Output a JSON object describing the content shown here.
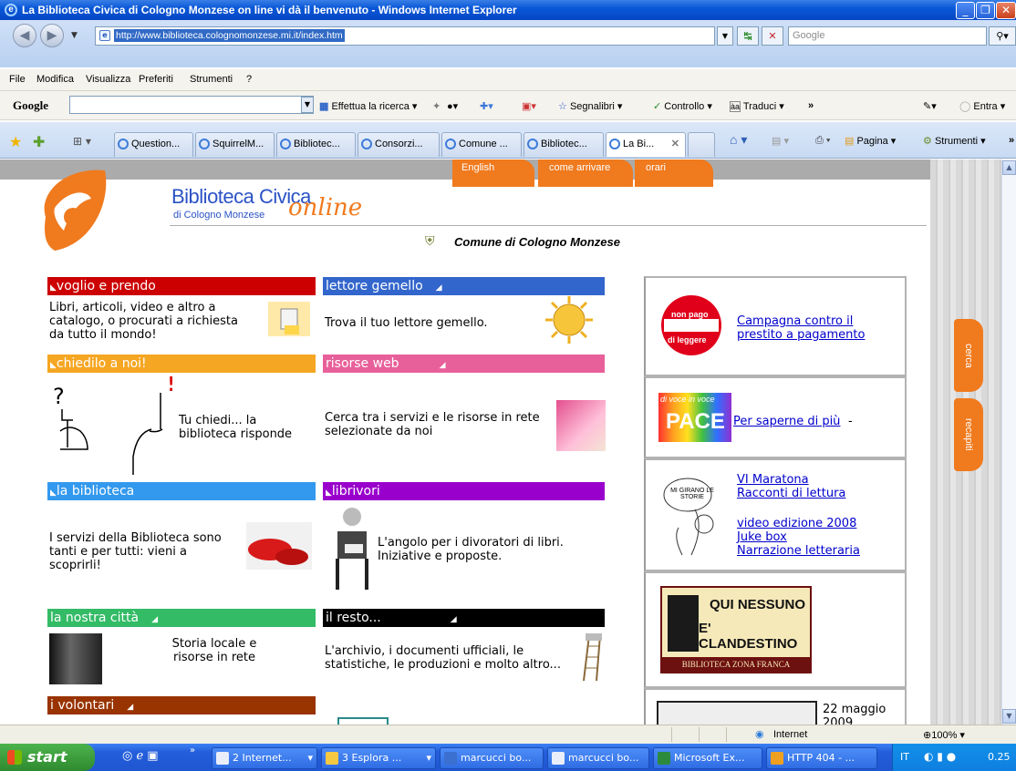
{
  "window": {
    "title": "La Biblioteca Civica di Cologno Monzese on line vi dà il benvenuto - Windows Internet Explorer"
  },
  "address": {
    "url": "http://www.biblioteca.colognomonzese.mi.it/index.htm",
    "search_placeholder": "Google"
  },
  "menu": [
    "File",
    "Modifica",
    "Visualizza",
    "Preferiti",
    "Strumenti",
    "?"
  ],
  "google_toolbar": {
    "logo": "Google",
    "search_label": "Effettua la ricerca",
    "bookmarks_label": "Segnalibri",
    "check_label": "Controllo",
    "translate_label": "Traduci",
    "more_label": "»",
    "signin_label": "Entra"
  },
  "tabs": [
    {
      "label": "Question..."
    },
    {
      "label": "SquirrelM..."
    },
    {
      "label": "Bibliotec..."
    },
    {
      "label": "Consorzi..."
    },
    {
      "label": "Comune ..."
    },
    {
      "label": "Bibliotec..."
    },
    {
      "label": "La Bi..."
    }
  ],
  "command_bar": {
    "page_label": "Pagina",
    "tools_label": "Strumenti"
  },
  "site": {
    "title": "Biblioteca Civica",
    "subtitle": "di Cologno Monzese",
    "online": "online",
    "nav": [
      "English",
      "come arrivare",
      "orari"
    ],
    "municipality": "Comune di Cologno Monzese",
    "side_tabs": [
      "cerca",
      "recapiti"
    ]
  },
  "sections": {
    "voglio": {
      "title": "voglio e prendo",
      "text": "Libri, articoli, video e altro a catalogo, o procurati a richiesta da tutto il mondo!",
      "color": "#cc0000"
    },
    "gemello": {
      "title": "lettore gemello",
      "text": "Trova il tuo lettore gemello.",
      "color": "#3366cc"
    },
    "chiedilo": {
      "title": "chiedilo a noi!",
      "text": "Tu chiedi... la biblioteca risponde",
      "color": "#f5a623"
    },
    "risorse": {
      "title": "risorse web",
      "text": "Cerca tra i servizi e le risorse in rete selezionate da noi",
      "color": "#e8609a"
    },
    "biblioteca": {
      "title": "la biblioteca",
      "text": "I servizi della Biblioteca sono tanti e per tutti: vieni a scoprirli!",
      "color": "#3399ee"
    },
    "librivori": {
      "title": "librivori",
      "text": "L'angolo per i divoratori di libri. Iniziative e proposte.",
      "color": "#9900cc"
    },
    "citta": {
      "title": "la nostra città",
      "text": "Storia locale e risorse in rete",
      "color": "#33bb66"
    },
    "resto": {
      "title": "il resto...",
      "text": "L'archivio, i documenti ufficiali, le statistiche, le produzioni e molto altro...",
      "color": "#000000"
    },
    "volontari": {
      "title": "i volontari",
      "color": "#993300"
    }
  },
  "sidebar": {
    "campaign_badge_top": "non pago",
    "campaign_badge_bottom": "di leggere",
    "campaign_link": "Campagna contro il prestito a pagamento",
    "pace_link": "Per saperne di più",
    "pace_suffix": " -",
    "pace_logo": "PACE",
    "pace_logo_caption": "di voce in voce",
    "maratona_line1": "VI Maratona",
    "maratona_line2": "Racconti di lettura",
    "video_link": "video edizione 2008",
    "juke_link": "Juke box",
    "narrazione_link": "Narrazione letteraria",
    "maratona_bubble": "MI GIRANO LE STORIE",
    "clandestino_line1": "QUI NESSUNO",
    "clandestino_line2": "E' CLANDESTINO",
    "clandestino_line3": "BIBLIOTECA ZONA FRANCA",
    "date_line1": "22 maggio",
    "date_line2": "2009"
  },
  "statusbar": {
    "zone": "Internet",
    "zoom": "100%"
  },
  "taskbar": {
    "start": "start",
    "items": [
      "2 Internet...",
      "3 Esplora ...",
      "marcucci bo...",
      "marcucci bo...",
      "Microsoft Ex...",
      "HTTP 404 - ..."
    ],
    "lang": "IT",
    "clock": "0.25"
  }
}
